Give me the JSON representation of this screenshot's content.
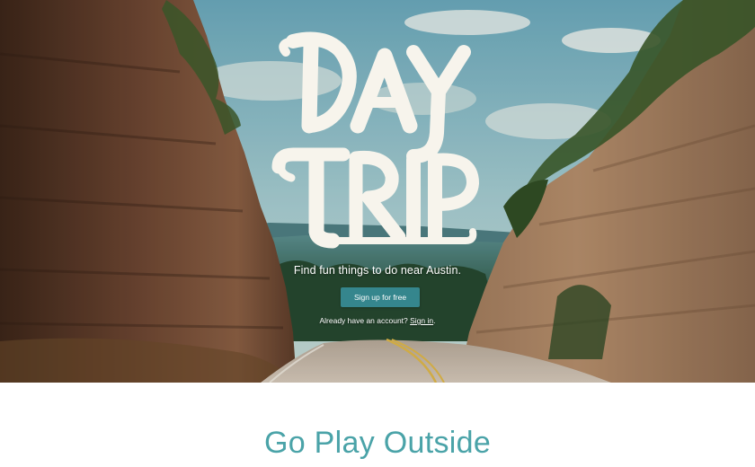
{
  "hero": {
    "logo_text": "DAY TRIP",
    "tagline": "Find fun things to do near Austin.",
    "signup_label": "Sign up for free",
    "account_prompt": "Already have an account?",
    "signin_label": "Sign in",
    "signin_suffix": "."
  },
  "section": {
    "title": "Go Play Outside"
  },
  "colors": {
    "button": "#35868d",
    "section_title": "#4aa3a8",
    "sky": "#7fb5c3",
    "cliff": "#7a5238"
  },
  "icons": [
    "day-trip-logo"
  ]
}
